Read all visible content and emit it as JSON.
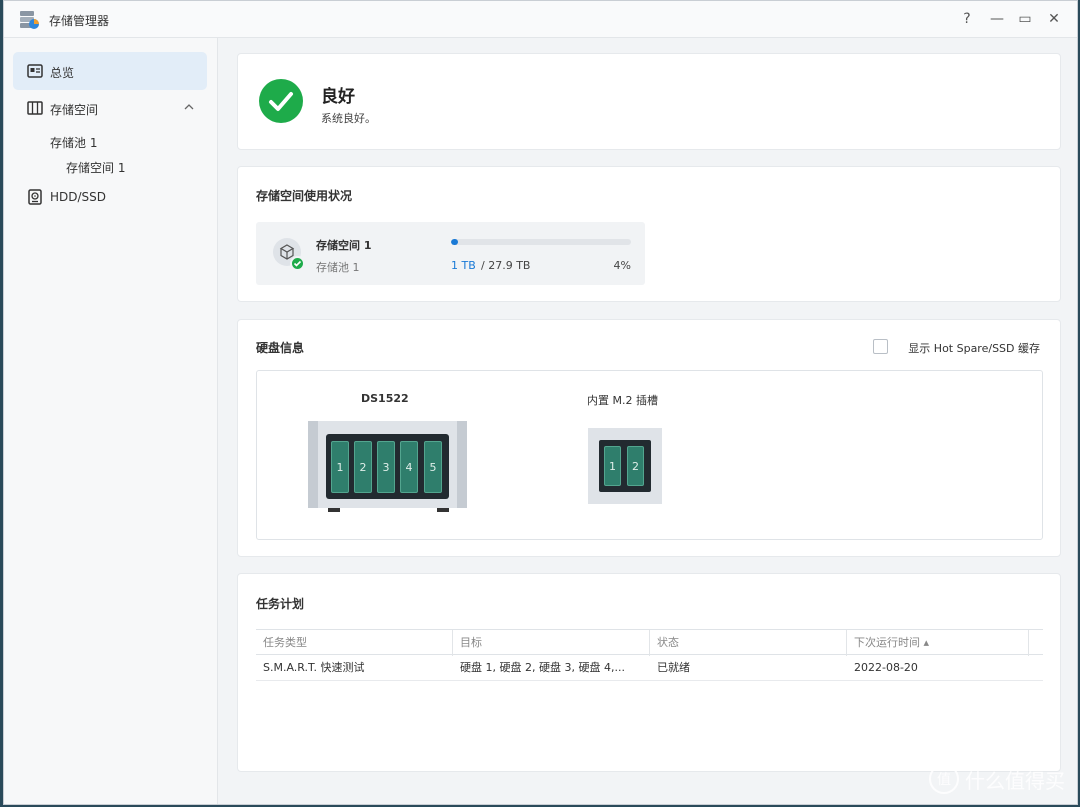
{
  "window": {
    "title": "存储管理器"
  },
  "titlebar": {
    "help": "?",
    "minimize": "—",
    "maximize": "▭",
    "close": "✕"
  },
  "sidebar": {
    "overview": "总览",
    "storage": "存储空间",
    "pool": "存储池 1",
    "volume": "存储空间 1",
    "hdd": "HDD/SSD"
  },
  "status": {
    "title": "良好",
    "desc": "系统良好。"
  },
  "usage": {
    "title": "存储空间使用状况",
    "volume_name": "存储空间 1",
    "pool_name": "存储池 1",
    "used": "1 TB",
    "total": "/ 27.9 TB",
    "percent_text": "4%",
    "percent_value": 4
  },
  "disk_info": {
    "title": "硬盘信息",
    "hotspare_label": "显示 Hot Spare/SSD 缓存",
    "nas_model": "DS1522",
    "m2_label": "内置 M.2 插槽",
    "bays": [
      "1",
      "2",
      "3",
      "4",
      "5"
    ],
    "m2_slots": [
      "1",
      "2"
    ]
  },
  "tasks": {
    "title": "任务计划",
    "columns": [
      "任务类型",
      "目标",
      "状态",
      "下次运行时间 ▴"
    ],
    "rows": [
      [
        "S.M.A.R.T. 快速测试",
        "硬盘 1, 硬盘 2, 硬盘 3, 硬盘 4,...",
        "已就绪",
        "2022-08-20"
      ]
    ]
  },
  "watermark": {
    "text": "什么值得买",
    "logo": "值"
  },
  "colors": {
    "accent": "#1a7ad6",
    "success": "#1eab4a",
    "disk_bay": "#2f7e6c"
  }
}
